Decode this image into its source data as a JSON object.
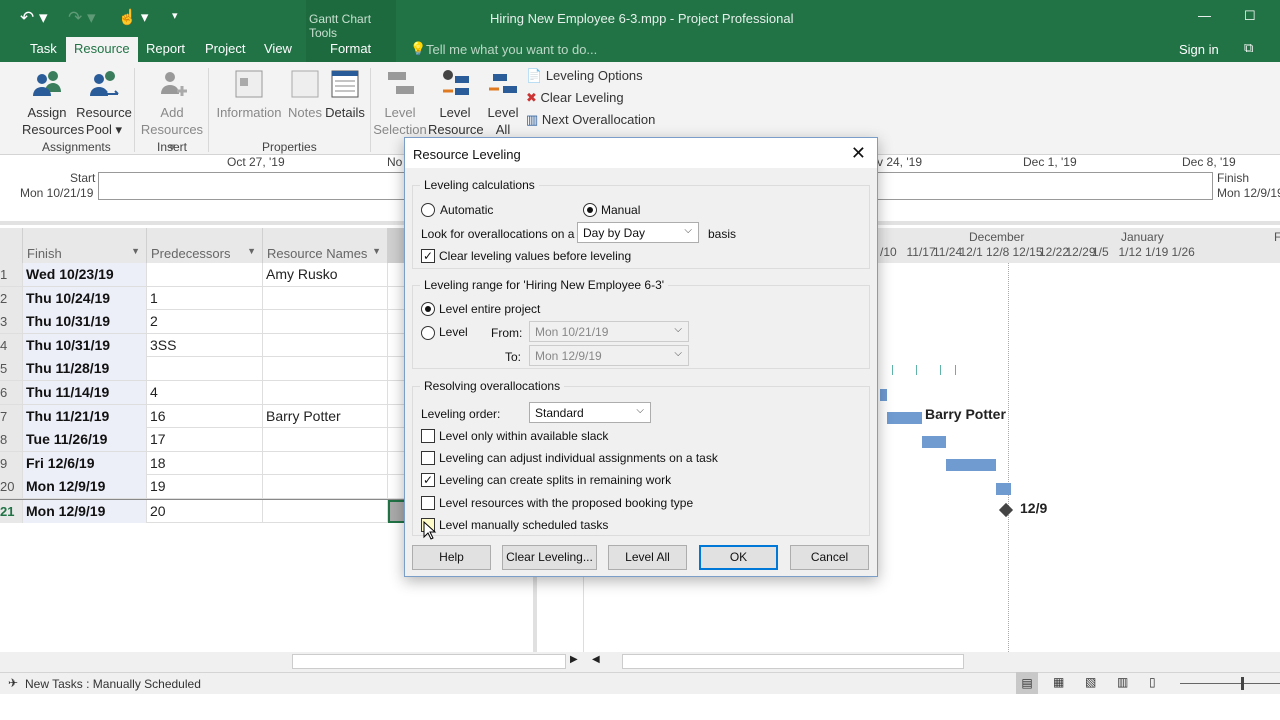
{
  "window": {
    "title": "Hiring New Employee 6-3.mpp - Project Professional",
    "context_tab_group": "Gantt Chart Tools",
    "sign_in": "Sign in"
  },
  "tabs": [
    {
      "label": "Task"
    },
    {
      "label": "Resource",
      "active": true
    },
    {
      "label": "Report"
    },
    {
      "label": "Project"
    },
    {
      "label": "View"
    },
    {
      "label": "Format"
    }
  ],
  "tell_me": "Tell me what you want to do...",
  "ribbon": {
    "assign_resources": "Assign Resources",
    "resource_pool": "Resource Pool",
    "add_resources": "Add Resources",
    "information": "Information",
    "notes": "Notes",
    "details": "Details",
    "level_selection": "Level Selection",
    "level_resource": "Level Resource",
    "level_all": "Level All",
    "leveling_options": "Leveling Options",
    "clear_leveling": "Clear Leveling",
    "next_overallocation": "Next Overallocation",
    "groups": {
      "assignments": "Assignments",
      "insert": "Insert",
      "properties": "Properties"
    }
  },
  "timeline": {
    "start_label": "Start",
    "start_date": "Mon 10/21/19",
    "finish_label": "Finish",
    "finish_date": "Mon 12/9/19",
    "ticks": [
      "Oct 27, '19",
      "No",
      "v 24, '19",
      "Dec 1, '19",
      "Dec 8, '19"
    ]
  },
  "table": {
    "columns": [
      "Finish",
      "Predecessors",
      "Resource Names"
    ],
    "rows": [
      {
        "id": "1",
        "finish": "Wed 10/23/19",
        "pred": "",
        "res": "Amy Rusko"
      },
      {
        "id": "2",
        "finish": "Thu 10/24/19",
        "pred": "1",
        "res": ""
      },
      {
        "id": "3",
        "finish": "Thu 10/31/19",
        "pred": "2",
        "res": ""
      },
      {
        "id": "4",
        "finish": "Thu 10/31/19",
        "pred": "3SS",
        "res": ""
      },
      {
        "id": "5",
        "finish": "Thu 11/28/19",
        "pred": "",
        "res": ""
      },
      {
        "id": "6",
        "finish": "Thu 11/14/19",
        "pred": "4",
        "res": ""
      },
      {
        "id": "7",
        "finish": "Thu 11/21/19",
        "pred": "16",
        "res": "Barry Potter"
      },
      {
        "id": "8",
        "finish": "Tue 11/26/19",
        "pred": "17",
        "res": ""
      },
      {
        "id": "9",
        "finish": "Fri 12/6/19",
        "pred": "18",
        "res": ""
      },
      {
        "id": "20",
        "finish": "Mon 12/9/19",
        "pred": "19",
        "res": ""
      },
      {
        "id": "21",
        "finish": "Mon 12/9/19",
        "pred": "20",
        "res": ""
      }
    ]
  },
  "gantt": {
    "months": [
      "December",
      "January",
      "F"
    ],
    "weeks": [
      "/10",
      "11/17",
      "11/24",
      "12/1",
      "12/8",
      "12/15",
      "12/22",
      "12/29",
      "1/5",
      "1/12",
      "1/19",
      "1/26"
    ],
    "bar_label": "Barry Potter",
    "milestone_label": "12/9",
    "bar_color": "#6f9bd1"
  },
  "dialog": {
    "title": "Resource Leveling",
    "calc": {
      "legend": "Leveling calculations",
      "automatic": "Automatic",
      "manual": "Manual",
      "mode": "manual",
      "look_for": "Look for overallocations on a",
      "basis_value": "Day by Day",
      "basis": "basis",
      "clear_values": "Clear leveling values before leveling",
      "clear_values_checked": true
    },
    "range": {
      "legend": "Leveling range for 'Hiring New Employee 6-3'",
      "entire": "Level entire project",
      "level": "Level",
      "from_label": "From:",
      "from": "Mon 10/21/19",
      "to_label": "To:",
      "to": "Mon 12/9/19"
    },
    "resolve": {
      "legend": "Resolving overallocations",
      "order_label": "Leveling order:",
      "order": "Standard",
      "options": [
        {
          "label": "Level only within available slack",
          "checked": false
        },
        {
          "label": "Leveling can adjust individual assignments on a task",
          "checked": false
        },
        {
          "label": "Leveling can create splits in remaining work",
          "checked": true
        },
        {
          "label": "Level resources with the proposed booking type",
          "checked": false
        },
        {
          "label": "Level manually scheduled tasks",
          "checked": false
        }
      ]
    },
    "buttons": {
      "help": "Help",
      "clear": "Clear Leveling...",
      "level_all": "Level All",
      "ok": "OK",
      "cancel": "Cancel"
    }
  },
  "status": {
    "text": "New Tasks : Manually Scheduled"
  },
  "colors": {
    "accent": "#217346",
    "checkbox_hover": "#fffbc8"
  }
}
